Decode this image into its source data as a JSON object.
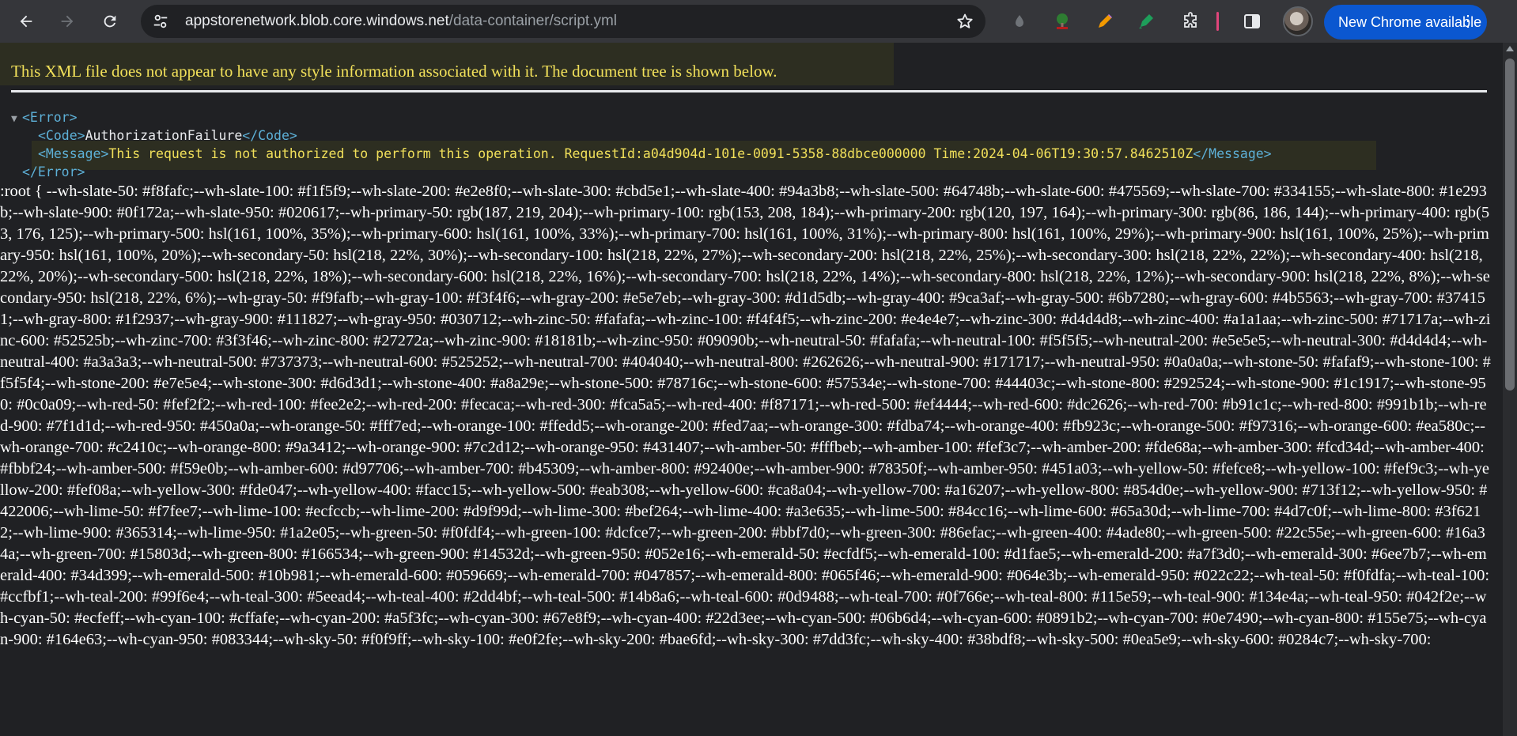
{
  "browser": {
    "url_host": "appstorenetwork.blob.core.windows.net",
    "url_path": "/data-container/script.yml",
    "update_button_label": "New Chrome available",
    "colors": {
      "toolbar_bg": "#35363a",
      "omnibox_bg": "#202124",
      "update_pill": "#0b57d0"
    },
    "icons": {
      "back": "arrow-left",
      "forward": "arrow-right",
      "reload": "circular-arrow",
      "site_info": "tune-sliders",
      "bookmark": "star-outline",
      "extensions": "puzzle-piece",
      "side_panel": "side-panel",
      "menu": "three-dots-vertical"
    }
  },
  "page": {
    "notice": "This XML file does not appear to have any style information associated with it. The document tree is shown below.",
    "xml": {
      "error_open": "<Error>",
      "code_open": "<Code>",
      "code_value": "AuthorizationFailure",
      "code_close": "</Code>",
      "message_open": "<Message>",
      "message_value": "This request is not authorized to perform this operation. RequestId:a04d904d-101e-0091-5358-88dbce000000 Time:2024-04-06T19:30:57.8462510Z",
      "message_close": "</Message>",
      "error_close": "</Error>"
    },
    "css_text": ":root { --wh-slate-50: #f8fafc;--wh-slate-100: #f1f5f9;--wh-slate-200: #e2e8f0;--wh-slate-300: #cbd5e1;--wh-slate-400: #94a3b8;--wh-slate-500: #64748b;--wh-slate-600: #475569;--wh-slate-700: #334155;--wh-slate-800: #1e293b;--wh-slate-900: #0f172a;--wh-slate-950: #020617;--wh-primary-50: rgb(187, 219, 204);--wh-primary-100: rgb(153, 208, 184);--wh-primary-200: rgb(120, 197, 164);--wh-primary-300: rgb(86, 186, 144);--wh-primary-400: rgb(53, 176, 125);--wh-primary-500: hsl(161, 100%, 35%);--wh-primary-600: hsl(161, 100%, 33%);--wh-primary-700: hsl(161, 100%, 31%);--wh-primary-800: hsl(161, 100%, 29%);--wh-primary-900: hsl(161, 100%, 25%);--wh-primary-950: hsl(161, 100%, 20%);--wh-secondary-50: hsl(218, 22%, 30%);--wh-secondary-100: hsl(218, 22%, 27%);--wh-secondary-200: hsl(218, 22%, 25%);--wh-secondary-300: hsl(218, 22%, 22%);--wh-secondary-400: hsl(218, 22%, 20%);--wh-secondary-500: hsl(218, 22%, 18%);--wh-secondary-600: hsl(218, 22%, 16%);--wh-secondary-700: hsl(218, 22%, 14%);--wh-secondary-800: hsl(218, 22%, 12%);--wh-secondary-900: hsl(218, 22%, 8%);--wh-secondary-950: hsl(218, 22%, 6%);--wh-gray-50: #f9fafb;--wh-gray-100: #f3f4f6;--wh-gray-200: #e5e7eb;--wh-gray-300: #d1d5db;--wh-gray-400: #9ca3af;--wh-gray-500: #6b7280;--wh-gray-600: #4b5563;--wh-gray-700: #374151;--wh-gray-800: #1f2937;--wh-gray-900: #111827;--wh-gray-950: #030712;--wh-zinc-50: #fafafa;--wh-zinc-100: #f4f4f5;--wh-zinc-200: #e4e4e7;--wh-zinc-300: #d4d4d8;--wh-zinc-400: #a1a1aa;--wh-zinc-500: #71717a;--wh-zinc-600: #52525b;--wh-zinc-700: #3f3f46;--wh-zinc-800: #27272a;--wh-zinc-900: #18181b;--wh-zinc-950: #09090b;--wh-neutral-50: #fafafa;--wh-neutral-100: #f5f5f5;--wh-neutral-200: #e5e5e5;--wh-neutral-300: #d4d4d4;--wh-neutral-400: #a3a3a3;--wh-neutral-500: #737373;--wh-neutral-600: #525252;--wh-neutral-700: #404040;--wh-neutral-800: #262626;--wh-neutral-900: #171717;--wh-neutral-950: #0a0a0a;--wh-stone-50: #fafaf9;--wh-stone-100: #f5f5f4;--wh-stone-200: #e7e5e4;--wh-stone-300: #d6d3d1;--wh-stone-400: #a8a29e;--wh-stone-500: #78716c;--wh-stone-600: #57534e;--wh-stone-700: #44403c;--wh-stone-800: #292524;--wh-stone-900: #1c1917;--wh-stone-950: #0c0a09;--wh-red-50: #fef2f2;--wh-red-100: #fee2e2;--wh-red-200: #fecaca;--wh-red-300: #fca5a5;--wh-red-400: #f87171;--wh-red-500: #ef4444;--wh-red-600: #dc2626;--wh-red-700: #b91c1c;--wh-red-800: #991b1b;--wh-red-900: #7f1d1d;--wh-red-950: #450a0a;--wh-orange-50: #fff7ed;--wh-orange-100: #ffedd5;--wh-orange-200: #fed7aa;--wh-orange-300: #fdba74;--wh-orange-400: #fb923c;--wh-orange-500: #f97316;--wh-orange-600: #ea580c;--wh-orange-700: #c2410c;--wh-orange-800: #9a3412;--wh-orange-900: #7c2d12;--wh-orange-950: #431407;--wh-amber-50: #fffbeb;--wh-amber-100: #fef3c7;--wh-amber-200: #fde68a;--wh-amber-300: #fcd34d;--wh-amber-400: #fbbf24;--wh-amber-500: #f59e0b;--wh-amber-600: #d97706;--wh-amber-700: #b45309;--wh-amber-800: #92400e;--wh-amber-900: #78350f;--wh-amber-950: #451a03;--wh-yellow-50: #fefce8;--wh-yellow-100: #fef9c3;--wh-yellow-200: #fef08a;--wh-yellow-300: #fde047;--wh-yellow-400: #facc15;--wh-yellow-500: #eab308;--wh-yellow-600: #ca8a04;--wh-yellow-700: #a16207;--wh-yellow-800: #854d0e;--wh-yellow-900: #713f12;--wh-yellow-950: #422006;--wh-lime-50: #f7fee7;--wh-lime-100: #ecfccb;--wh-lime-200: #d9f99d;--wh-lime-300: #bef264;--wh-lime-400: #a3e635;--wh-lime-500: #84cc16;--wh-lime-600: #65a30d;--wh-lime-700: #4d7c0f;--wh-lime-800: #3f6212;--wh-lime-900: #365314;--wh-lime-950: #1a2e05;--wh-green-50: #f0fdf4;--wh-green-100: #dcfce7;--wh-green-200: #bbf7d0;--wh-green-300: #86efac;--wh-green-400: #4ade80;--wh-green-500: #22c55e;--wh-green-600: #16a34a;--wh-green-700: #15803d;--wh-green-800: #166534;--wh-green-900: #14532d;--wh-green-950: #052e16;--wh-emerald-50: #ecfdf5;--wh-emerald-100: #d1fae5;--wh-emerald-200: #a7f3d0;--wh-emerald-300: #6ee7b7;--wh-emerald-400: #34d399;--wh-emerald-500: #10b981;--wh-emerald-600: #059669;--wh-emerald-700: #047857;--wh-emerald-800: #065f46;--wh-emerald-900: #064e3b;--wh-emerald-950: #022c22;--wh-teal-50: #f0fdfa;--wh-teal-100: #ccfbf1;--wh-teal-200: #99f6e4;--wh-teal-300: #5eead4;--wh-teal-400: #2dd4bf;--wh-teal-500: #14b8a6;--wh-teal-600: #0d9488;--wh-teal-700: #0f766e;--wh-teal-800: #115e59;--wh-teal-900: #134e4a;--wh-teal-950: #042f2e;--wh-cyan-50: #ecfeff;--wh-cyan-100: #cffafe;--wh-cyan-200: #a5f3fc;--wh-cyan-300: #67e8f9;--wh-cyan-400: #22d3ee;--wh-cyan-500: #06b6d4;--wh-cyan-600: #0891b2;--wh-cyan-700: #0e7490;--wh-cyan-800: #155e75;--wh-cyan-900: #164e63;--wh-cyan-950: #083344;--wh-sky-50: #f0f9ff;--wh-sky-100: #e0f2fe;--wh-sky-200: #bae6fd;--wh-sky-300: #7dd3fc;--wh-sky-400: #38bdf8;--wh-sky-500: #0ea5e9;--wh-sky-600: #0284c7;--wh-sky-700:"
  }
}
